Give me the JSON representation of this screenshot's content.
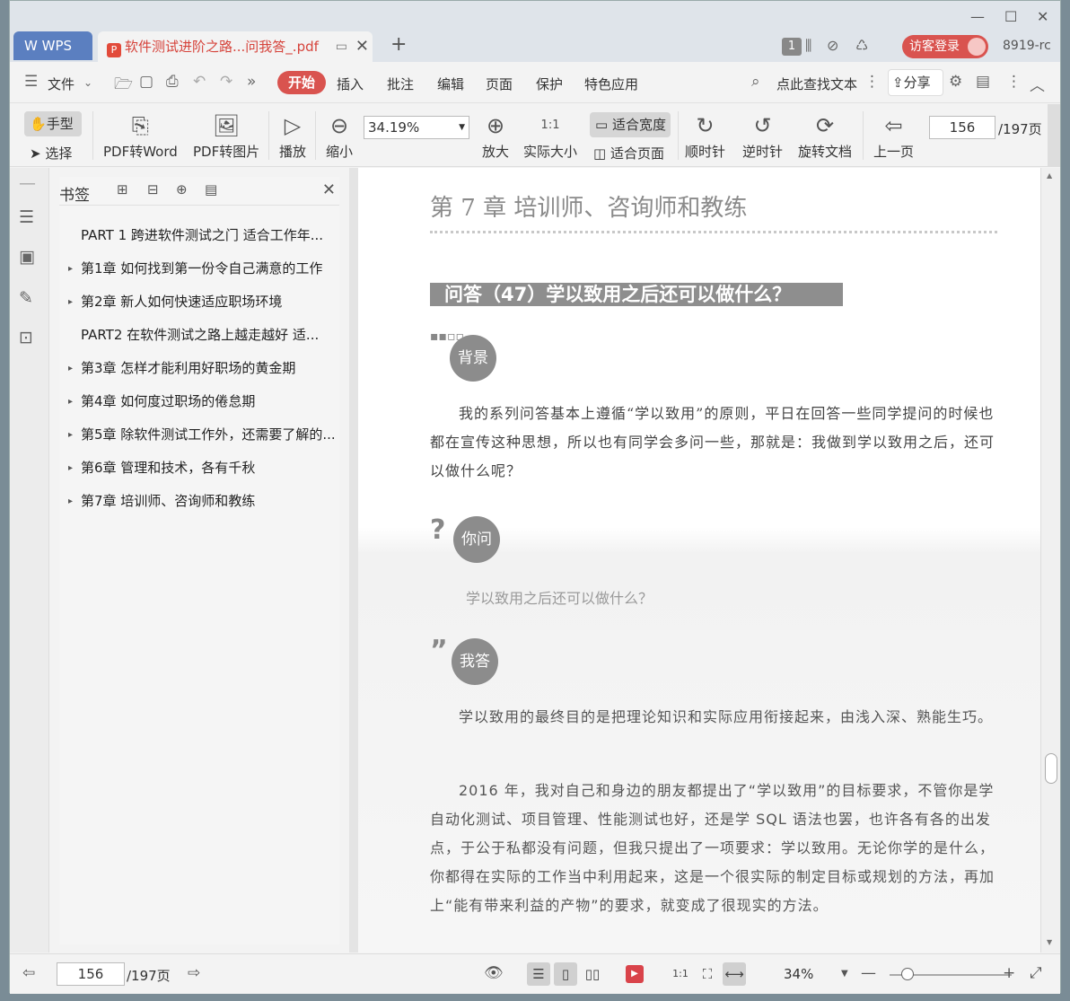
{
  "window": {
    "minimize": "—",
    "maximize": "☐",
    "close": "✕"
  },
  "tabs": {
    "wps_label": "WPS",
    "doc_label": "软件测试进阶之路...问我答_.pdf",
    "add": "+"
  },
  "titlebar": {
    "badge": "1",
    "login_label": "访客登录",
    "account": "8919-rc"
  },
  "menu": {
    "items": [
      "文件",
      "开始",
      "插入",
      "批注",
      "编辑",
      "页面",
      "保护",
      "特色应用"
    ],
    "search_label": "点此查找文本",
    "share_label": "分享"
  },
  "toolbar": {
    "hand": "手型",
    "select": "选择",
    "pdf_to_word": "PDF转Word",
    "pdf_to_image": "PDF转图片",
    "play": "播放",
    "zoom_out": "缩小",
    "zoom_value": "34.19%",
    "zoom_in": "放大",
    "actual_size": "实际大小",
    "actual_icon": "1:1",
    "fit_width": "适合宽度",
    "fit_page": "适合页面",
    "clockwise": "顺时针",
    "counter_clockwise": "逆时针",
    "rotate_doc": "旋转文档",
    "prev_page": "上一页",
    "page_value": "156",
    "page_total": "/197页"
  },
  "bookmarks": {
    "title": "书签",
    "items": [
      {
        "label": "PART 1  跨进软件测试之门  适合工作年...",
        "expandable": false
      },
      {
        "label": "第1章  如何找到第一份令自己满意的工作",
        "expandable": true
      },
      {
        "label": "第2章  新人如何快速适应职场环境",
        "expandable": true
      },
      {
        "label": "PART2  在软件测试之路上越走越好  适...",
        "expandable": false
      },
      {
        "label": "第3章  怎样才能利用好职场的黄金期",
        "expandable": true
      },
      {
        "label": "第4章  如何度过职场的倦怠期",
        "expandable": true
      },
      {
        "label": "第5章  除软件测试工作外，还需要了解的...",
        "expandable": true
      },
      {
        "label": "第6章  管理和技术，各有千秋",
        "expandable": true
      },
      {
        "label": "第7章  培训师、咨询师和教练",
        "expandable": true
      }
    ]
  },
  "document": {
    "chapter_title": "第 7 章    培训师、咨询师和教练",
    "qa_title": "问答（47）学以致用之后还可以做什么？",
    "bg_label": "背景",
    "bg_prefix": "▪▪▫▫",
    "bg_text": "我的系列问答基本上遵循“学以致用”的原则，平日在回答一些同学提问的时候也都在宣传这种思想，所以也有同学会多问一些，那就是：我做到学以致用之后，还可以做什么呢？",
    "ask_label": "你问",
    "ask_prefix": "?",
    "ask_text": "学以致用之后还可以做什么？",
    "answer_label": "我答",
    "answer_prefix": "”",
    "answer_p1": "学以致用的最终目的是把理论知识和实际应用衔接起来，由浅入深、熟能生巧。",
    "answer_p2": "2016 年，我对自己和身边的朋友都提出了“学以致用”的目标要求，不管你是学自动化测试、项目管理、性能测试也好，还是学 SQL 语法也罢，也许各有各的出发点，于公于私都没有问题，但我只提出了一项要求：学以致用。无论你学的是什么，你都得在实际的工作当中利用起来，这是一个很实际的制定目标或规划的方法，再加上“能有带来利益的产物”的要求，就变成了很现实的方法。"
  },
  "statusbar": {
    "page_value": "156",
    "page_total": "/197页",
    "zoom": "34%",
    "zoom_level": 0.15,
    "minus": "—",
    "plus": "+"
  }
}
